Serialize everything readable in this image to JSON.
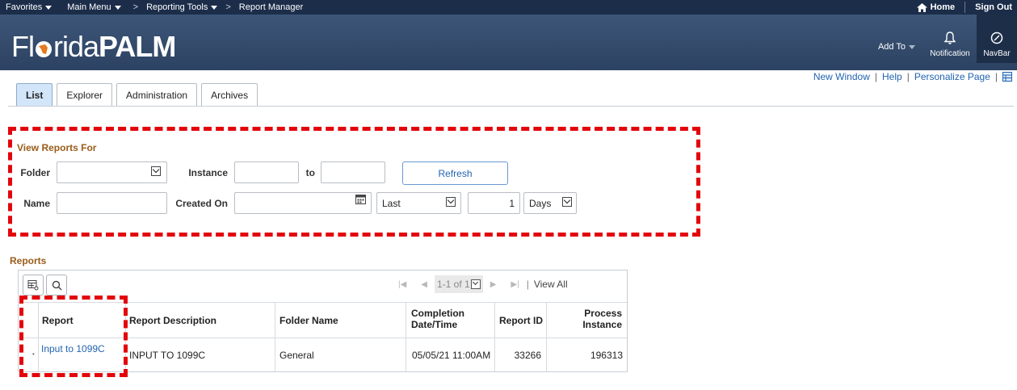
{
  "topbar": {
    "favorites": "Favorites",
    "main_menu": "Main Menu",
    "breadcrumb_sep_1": ">",
    "reporting_tools": "Reporting Tools",
    "breadcrumb_sep_2": ">",
    "report_manager": "Report Manager",
    "home": "Home",
    "sign_out": "Sign Out"
  },
  "banner": {
    "logo_part1": "Fl",
    "logo_part2": "rida",
    "logo_part3": "PALM",
    "add_to": "Add To",
    "notification": "Notification",
    "navbar": "NavBar"
  },
  "page_links": {
    "new_window": "New Window",
    "help": "Help",
    "personalize_page": "Personalize Page",
    "sep": "|"
  },
  "tabs": [
    {
      "label": "List",
      "active": true
    },
    {
      "label": "Explorer",
      "active": false
    },
    {
      "label": "Administration",
      "active": false
    },
    {
      "label": "Archives",
      "active": false
    }
  ],
  "view_reports": {
    "title": "View Reports For",
    "folder_label": "Folder",
    "folder_value": "",
    "instance_label": "Instance",
    "instance_from": "",
    "to_label": "to",
    "instance_to": "",
    "refresh": "Refresh",
    "name_label": "Name",
    "name_value": "",
    "created_on_label": "Created On",
    "created_on_value": "",
    "last_value": "Last",
    "last_count": "1",
    "days_value": "Days"
  },
  "reports": {
    "title": "Reports",
    "pager_count": "1-1 of 1",
    "view_all": "View All",
    "pager_sep": "|",
    "columns": {
      "report": "Report",
      "description": "Report Description",
      "folder": "Folder Name",
      "completion_1": "Completion",
      "completion_2": "Date/Time",
      "report_id": "Report ID",
      "process_1": "Process",
      "process_2": "Instance"
    },
    "rows": [
      {
        "report": "Input to 1099C",
        "description": "INPUT TO 1099C",
        "folder": "General",
        "completion": "05/05/21 11:00AM",
        "report_id": "33266",
        "process_instance": "196313"
      }
    ]
  },
  "colors": {
    "topbar": "#1c2d4a",
    "banner": "#34496b",
    "highlight": "#e3050b",
    "section_title": "#995c1a",
    "link": "#2264b0"
  }
}
